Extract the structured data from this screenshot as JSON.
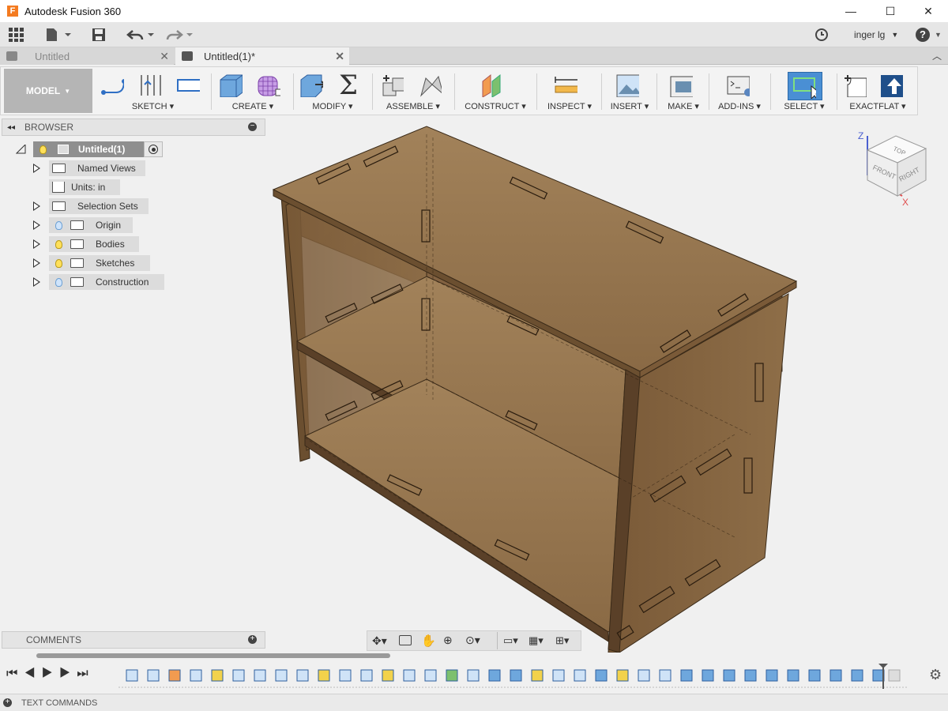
{
  "window": {
    "title": "Autodesk Fusion 360",
    "logo_letter": "F"
  },
  "quick_access": {
    "user": "inger lg",
    "help": "?"
  },
  "tabs": [
    {
      "label": "Untitled",
      "active": false
    },
    {
      "label": "Untitled(1)*",
      "active": true
    }
  ],
  "toolbar": {
    "workspace": "MODEL",
    "groups": [
      "SKETCH",
      "CREATE",
      "MODIFY",
      "ASSEMBLE",
      "CONSTRUCT",
      "INSPECT",
      "INSERT",
      "MAKE",
      "ADD-INS",
      "SELECT",
      "EXACTFLAT"
    ]
  },
  "browser": {
    "title": "BROWSER",
    "root": "Untitled(1)",
    "items": [
      {
        "label": "Named Views",
        "bulb": ""
      },
      {
        "label": "Units: in",
        "bulb": ""
      },
      {
        "label": "Selection Sets",
        "bulb": ""
      },
      {
        "label": "Origin",
        "bulb": "blue"
      },
      {
        "label": "Bodies",
        "bulb": "yellow"
      },
      {
        "label": "Sketches",
        "bulb": "yellow"
      },
      {
        "label": "Construction",
        "bulb": "blue"
      }
    ]
  },
  "viewcube": {
    "top": "TOP",
    "front": "FRONT",
    "right": "RIGHT",
    "axis_x": "X",
    "axis_z": "Z"
  },
  "comments": {
    "label": "COMMENTS"
  },
  "text_commands": {
    "label": "TEXT COMMANDS"
  },
  "colors": {
    "accent": "#4a8fd4",
    "model_bg": "#b5b5b5",
    "wood": "#8a6a45"
  }
}
